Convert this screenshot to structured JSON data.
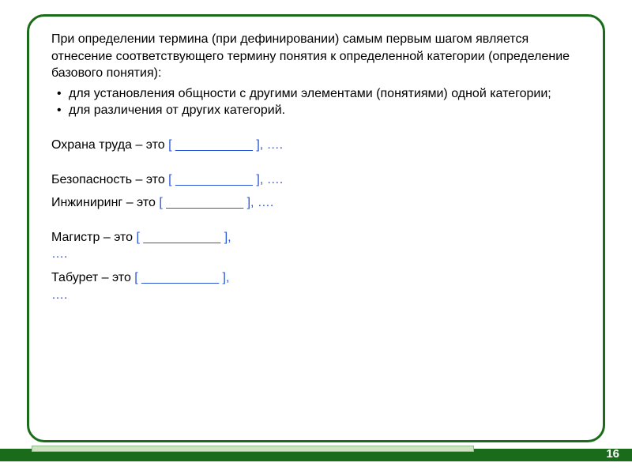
{
  "colors": {
    "frame_border": "#1a6c1a",
    "accent_blue": "#2a56d8"
  },
  "intro": "При определении термина (при дефинировании) самым первым шагом является отнесение соответствующего термину понятия к определенной категории (определение базового понятия):",
  "bullets": [
    "для установления общности с другими элементами (понятиями) одной категории;",
    "для различения от других категорий."
  ],
  "examples": [
    {
      "term": "Охрана труда",
      "sep": " – это ",
      "open": "[ ",
      "blank": "___________",
      "close": "  ], ",
      "dots": "….",
      "gap": true,
      "two_line": false
    },
    {
      "term": "Безопасность",
      "sep": " – это ",
      "open": "[ ",
      "blank": "___________",
      "close": "  ], ",
      "dots": "….",
      "gap": true,
      "two_line": false
    },
    {
      "term": "Инжиниринг",
      "sep": " – это ",
      "open": "[ ",
      "blank": "___________",
      "close": "  ], ",
      "dots": "….",
      "gap": false,
      "two_line": false
    },
    {
      "term": "Магистр",
      "sep": " – это ",
      "open": "[ ",
      "blank": "___________",
      "close": "  ], ",
      "dots": "….",
      "gap": true,
      "two_line": true
    },
    {
      "term": "Табурет",
      "sep": " – это ",
      "open": "[ ",
      "blank": "___________",
      "close": "  ], ",
      "dots": "….",
      "gap": false,
      "two_line": true
    }
  ],
  "page_number": "16"
}
